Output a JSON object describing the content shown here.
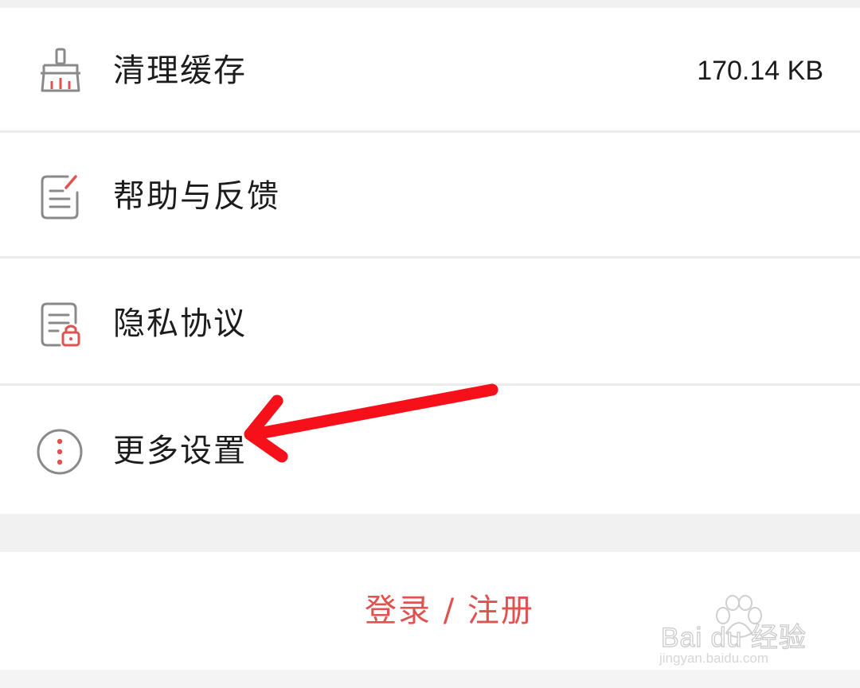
{
  "settings": {
    "items": [
      {
        "label": "清理缓存",
        "value": "170.14 KB",
        "icon": "broom-icon"
      },
      {
        "label": "帮助与反馈",
        "value": "",
        "icon": "feedback-document-icon"
      },
      {
        "label": "隐私协议",
        "value": "",
        "icon": "privacy-document-lock-icon"
      },
      {
        "label": "更多设置",
        "value": "",
        "icon": "more-dots-circle-icon"
      }
    ]
  },
  "login": {
    "label": "登录 / 注册"
  },
  "watermark": {
    "brand": "Bai du 经验",
    "url": "jingyan.baidu.com"
  },
  "colors": {
    "accent": "#e0524f",
    "icon_gray": "#8a8a8a",
    "annotation_arrow": "#f5101a",
    "separator": "#ececec",
    "section_gap": "#f1f1f1"
  }
}
